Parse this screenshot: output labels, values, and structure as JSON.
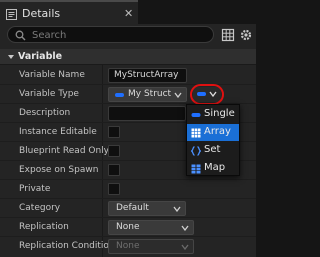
{
  "window": {
    "title": "Details",
    "close_glyph": "✕"
  },
  "search": {
    "placeholder": "Search"
  },
  "section": {
    "title": "Variable"
  },
  "rows": {
    "variable_name": {
      "label": "Variable Name",
      "value": "MyStructArray"
    },
    "variable_type": {
      "label": "Variable Type",
      "value": "My Struct"
    },
    "description": {
      "label": "Description"
    },
    "instance_editable": {
      "label": "Instance Editable"
    },
    "blueprint_read_only": {
      "label": "Blueprint Read Only"
    },
    "expose_on_spawn": {
      "label": "Expose on Spawn"
    },
    "private": {
      "label": "Private"
    },
    "category": {
      "label": "Category",
      "value": "Default"
    },
    "replication": {
      "label": "Replication",
      "value": "None"
    },
    "replication_condition": {
      "label": "Replication Condition",
      "value": "None"
    }
  },
  "container_menu": {
    "selected": "Array",
    "items": [
      {
        "label": "Single",
        "icon": "single-pill-icon"
      },
      {
        "label": "Array",
        "icon": "array-grid-icon"
      },
      {
        "label": "Set",
        "icon": "set-braces-icon"
      },
      {
        "label": "Map",
        "icon": "map-grid-icon"
      }
    ]
  },
  "colors": {
    "accent": "#1a6fd6",
    "type_pill": "#1f6fff",
    "highlight_ring": "#e01010"
  }
}
